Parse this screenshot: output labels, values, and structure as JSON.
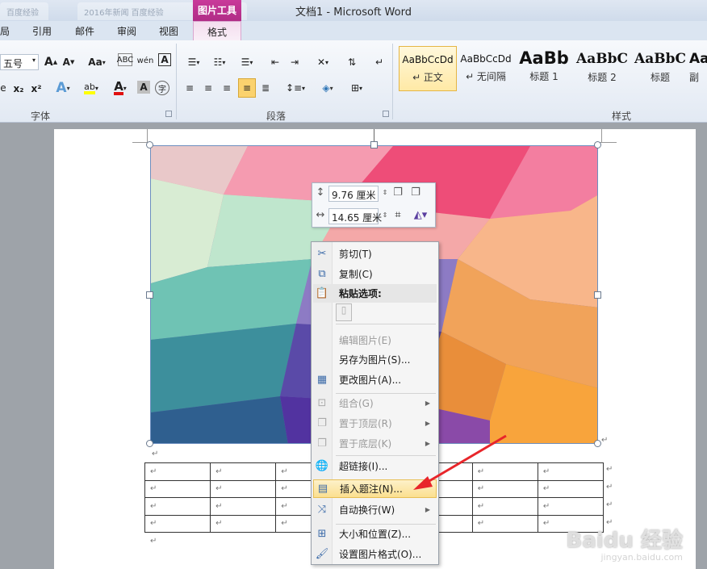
{
  "titlebar": {
    "title": "文档1 - Microsoft Word",
    "ghost_tab_1": "百度经验",
    "ghost_tab_2": "2016年新闻 百度经验",
    "context_tool": "图片工具"
  },
  "ribbon_tabs": [
    "局",
    "引用",
    "邮件",
    "审阅",
    "视图"
  ],
  "context_tab": "格式",
  "font_group": {
    "size_value": "五号",
    "label": "字体",
    "grow_label": "A",
    "shrink_label": "A",
    "case_label": "Aa",
    "phonetic_label": "wén",
    "border_label": "A",
    "sub_label": "x₂",
    "sup_label": "x²",
    "effects_label": "A",
    "highlight_label": "ab",
    "color_label": "A",
    "shade_label": "A",
    "enclose_label": "字",
    "colors": {
      "highlight": "#ffff00",
      "font": "#e01010"
    }
  },
  "paragraph_group": {
    "label": "段落"
  },
  "styles_group": {
    "label": "样式",
    "items": [
      {
        "sample": "AaBbCcDd",
        "name": "↵ 正文"
      },
      {
        "sample": "AaBbCcDd",
        "name": "↵ 无间隔"
      },
      {
        "sample": "AaBb",
        "name": "标题 1"
      },
      {
        "sample": "AaBbC",
        "name": "标题 2"
      },
      {
        "sample": "AaBbC",
        "name": "标题"
      },
      {
        "sample": "Aa",
        "name": "副"
      }
    ]
  },
  "minibar": {
    "height_value": "9.76 厘米",
    "width_value": "14.65 厘米"
  },
  "context_menu": {
    "items": [
      {
        "label": "剪切(T)",
        "icon": "scissors-icon",
        "glyph": "✂",
        "disabled": false
      },
      {
        "label": "复制(C)",
        "icon": "copy-icon",
        "glyph": "⧉",
        "disabled": false
      },
      {
        "label": "粘贴选项:",
        "icon": "paste-icon",
        "glyph": "📋",
        "header": true
      },
      {
        "label": "编辑图片(E)",
        "icon": "edit-picture-icon",
        "glyph": "",
        "disabled": true
      },
      {
        "label": "另存为图片(S)...",
        "icon": "",
        "glyph": "",
        "disabled": false
      },
      {
        "label": "更改图片(A)...",
        "icon": "change-picture-icon",
        "glyph": "▦",
        "disabled": false
      },
      {
        "label": "组合(G)",
        "icon": "group-icon",
        "glyph": "⊡",
        "disabled": true,
        "submenu": true
      },
      {
        "label": "置于顶层(R)",
        "icon": "bring-front-icon",
        "glyph": "❐",
        "disabled": true,
        "submenu": true
      },
      {
        "label": "置于底层(K)",
        "icon": "send-back-icon",
        "glyph": "❐",
        "disabled": true,
        "submenu": true
      },
      {
        "label": "超链接(I)...",
        "icon": "hyperlink-icon",
        "glyph": "🌐",
        "disabled": false
      },
      {
        "label": "插入题注(N)...",
        "icon": "caption-icon",
        "glyph": "▤",
        "disabled": false,
        "highlight": true
      },
      {
        "label": "自动换行(W)",
        "icon": "wrap-text-icon",
        "glyph": "⤨",
        "disabled": false,
        "submenu": true
      },
      {
        "label": "大小和位置(Z)...",
        "icon": "size-position-icon",
        "glyph": "⊞",
        "disabled": false
      },
      {
        "label": "设置图片格式(O)...",
        "icon": "format-picture-icon",
        "glyph": "🖌",
        "disabled": false
      }
    ]
  },
  "document": {
    "para_mark": "↵",
    "table_rows": 4,
    "table_cols": 7
  },
  "watermark": {
    "brand": "Baidu 经验",
    "url": "jingyan.baidu.com"
  }
}
